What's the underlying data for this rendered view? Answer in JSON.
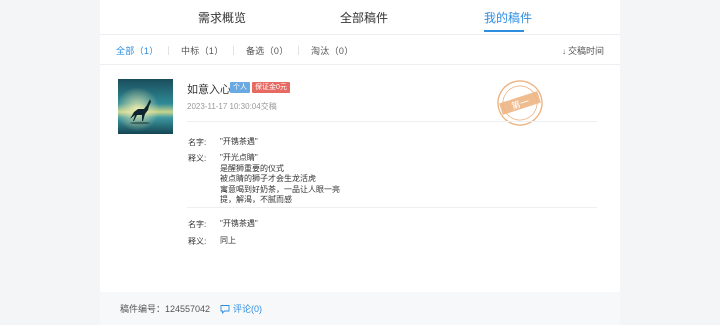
{
  "tabs": [
    {
      "label": "需求概览"
    },
    {
      "label": "全部稿件"
    },
    {
      "label": "我的稿件"
    }
  ],
  "filters": [
    {
      "label": "全部（1）"
    },
    {
      "label": "中标（1）"
    },
    {
      "label": "备选（0）"
    },
    {
      "label": "淘汰（0）"
    }
  ],
  "sort": {
    "label": "交稿时间"
  },
  "entry": {
    "name": "如意入心",
    "badges": [
      "个人",
      "保证金0元"
    ],
    "time": "2023-11-17 10:30:04交稿",
    "stamp_text": "第一",
    "proposals": [
      {
        "name_label": "名字:",
        "name_value": "\"开镌茶遇\"",
        "desc_label": "释义:",
        "desc_lines": [
          "\"开光点睛\"",
          "是醒狮重要的仪式",
          "被点睛的狮子才会生龙活虎",
          "寓意喝到好奶茶，一品让人眼一亮",
          "提，解渴，不腻而感"
        ]
      },
      {
        "name_label": "名字:",
        "name_value": "\"开镌茶遇\"",
        "desc_label": "释义:",
        "desc_lines": [
          "同上"
        ]
      }
    ]
  },
  "footer": {
    "work_id": "稿件编号：124557042",
    "comment": "评论(0)"
  },
  "colors": {
    "accent": "#2f8ee0",
    "badge_person": "#6aa9e2",
    "badge_deposit": "#e66a62",
    "stamp": "#e8a06a"
  }
}
